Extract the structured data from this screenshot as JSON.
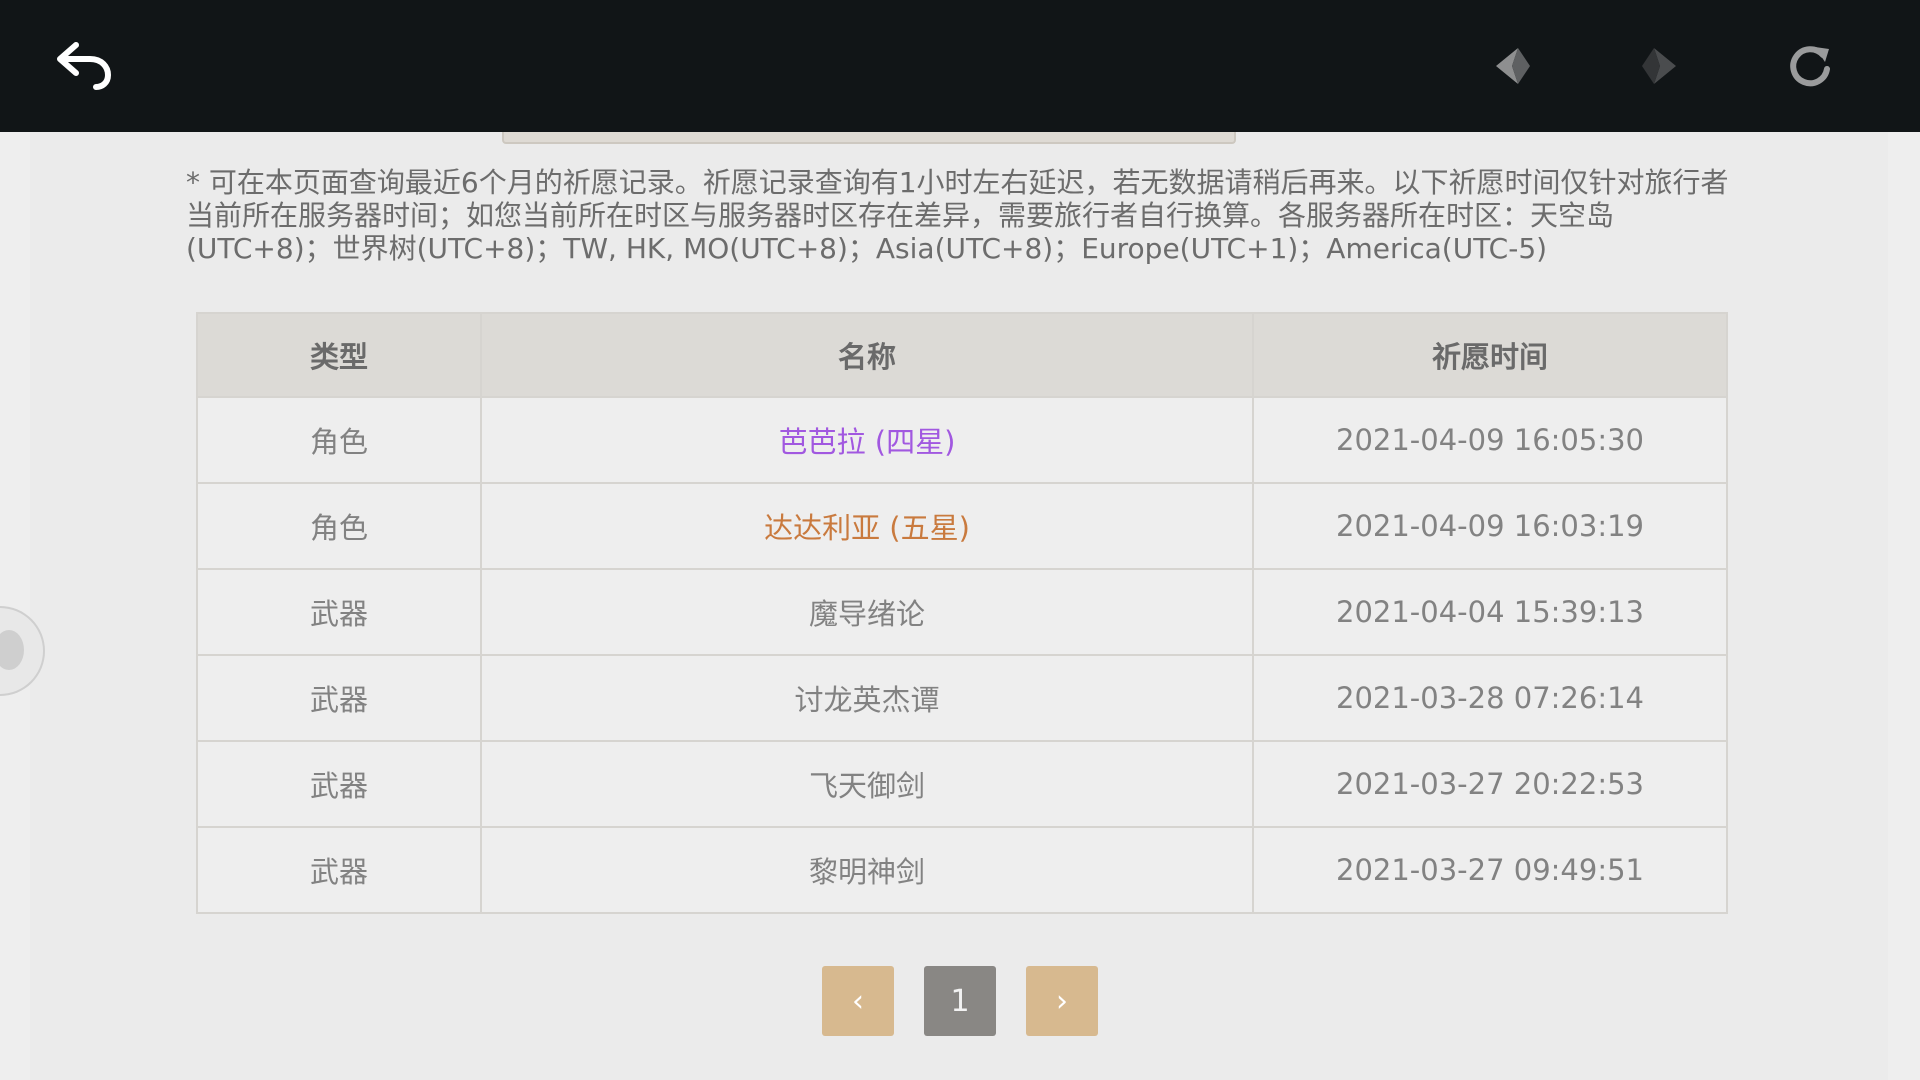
{
  "topbar": {
    "icons": {
      "back": "back-arrow-icon",
      "prev": "prev-arrow-icon",
      "next": "next-arrow-icon",
      "refresh": "refresh-icon"
    }
  },
  "notice": "* 可在本页面查询最近6个月的祈愿记录。祈愿记录查询有1小时左右延迟，若无数据请稍后再来。以下祈愿时间仅针对旅行者当前所在服务器时间；如您当前所在时区与服务器时区存在差异，需要旅行者自行换算。各服务器所在时区：天空岛(UTC+8)；世界树(UTC+8)；TW, HK, MO(UTC+8)；Asia(UTC+8)；Europe(UTC+1)；America(UTC-5)",
  "table": {
    "headers": [
      "类型",
      "名称",
      "祈愿时间"
    ],
    "rows": [
      {
        "type": "角色",
        "name": "芭芭拉 (四星)",
        "time": "2021-04-09 16:05:30",
        "color": "#a158e0"
      },
      {
        "type": "角色",
        "name": "达达利亚 (五星)",
        "time": "2021-04-09 16:03:19",
        "color": "#c97a3e"
      },
      {
        "type": "武器",
        "name": "魔导绪论",
        "time": "2021-04-04 15:39:13",
        "color": "#828282"
      },
      {
        "type": "武器",
        "name": "讨龙英杰谭",
        "time": "2021-03-28 07:26:14",
        "color": "#828282"
      },
      {
        "type": "武器",
        "name": "飞天御剑",
        "time": "2021-03-27 20:22:53",
        "color": "#828282"
      },
      {
        "type": "武器",
        "name": "黎明神剑",
        "time": "2021-03-27 09:49:51",
        "color": "#828282"
      }
    ]
  },
  "pagination": {
    "prev_label": "‹",
    "current_label": "1",
    "next_label": "›"
  },
  "colors": {
    "topbar": "#111517",
    "page_button": "#d7b98f",
    "page_current": "#898784",
    "four_star": "#a158e0",
    "five_star": "#c97a3e"
  }
}
